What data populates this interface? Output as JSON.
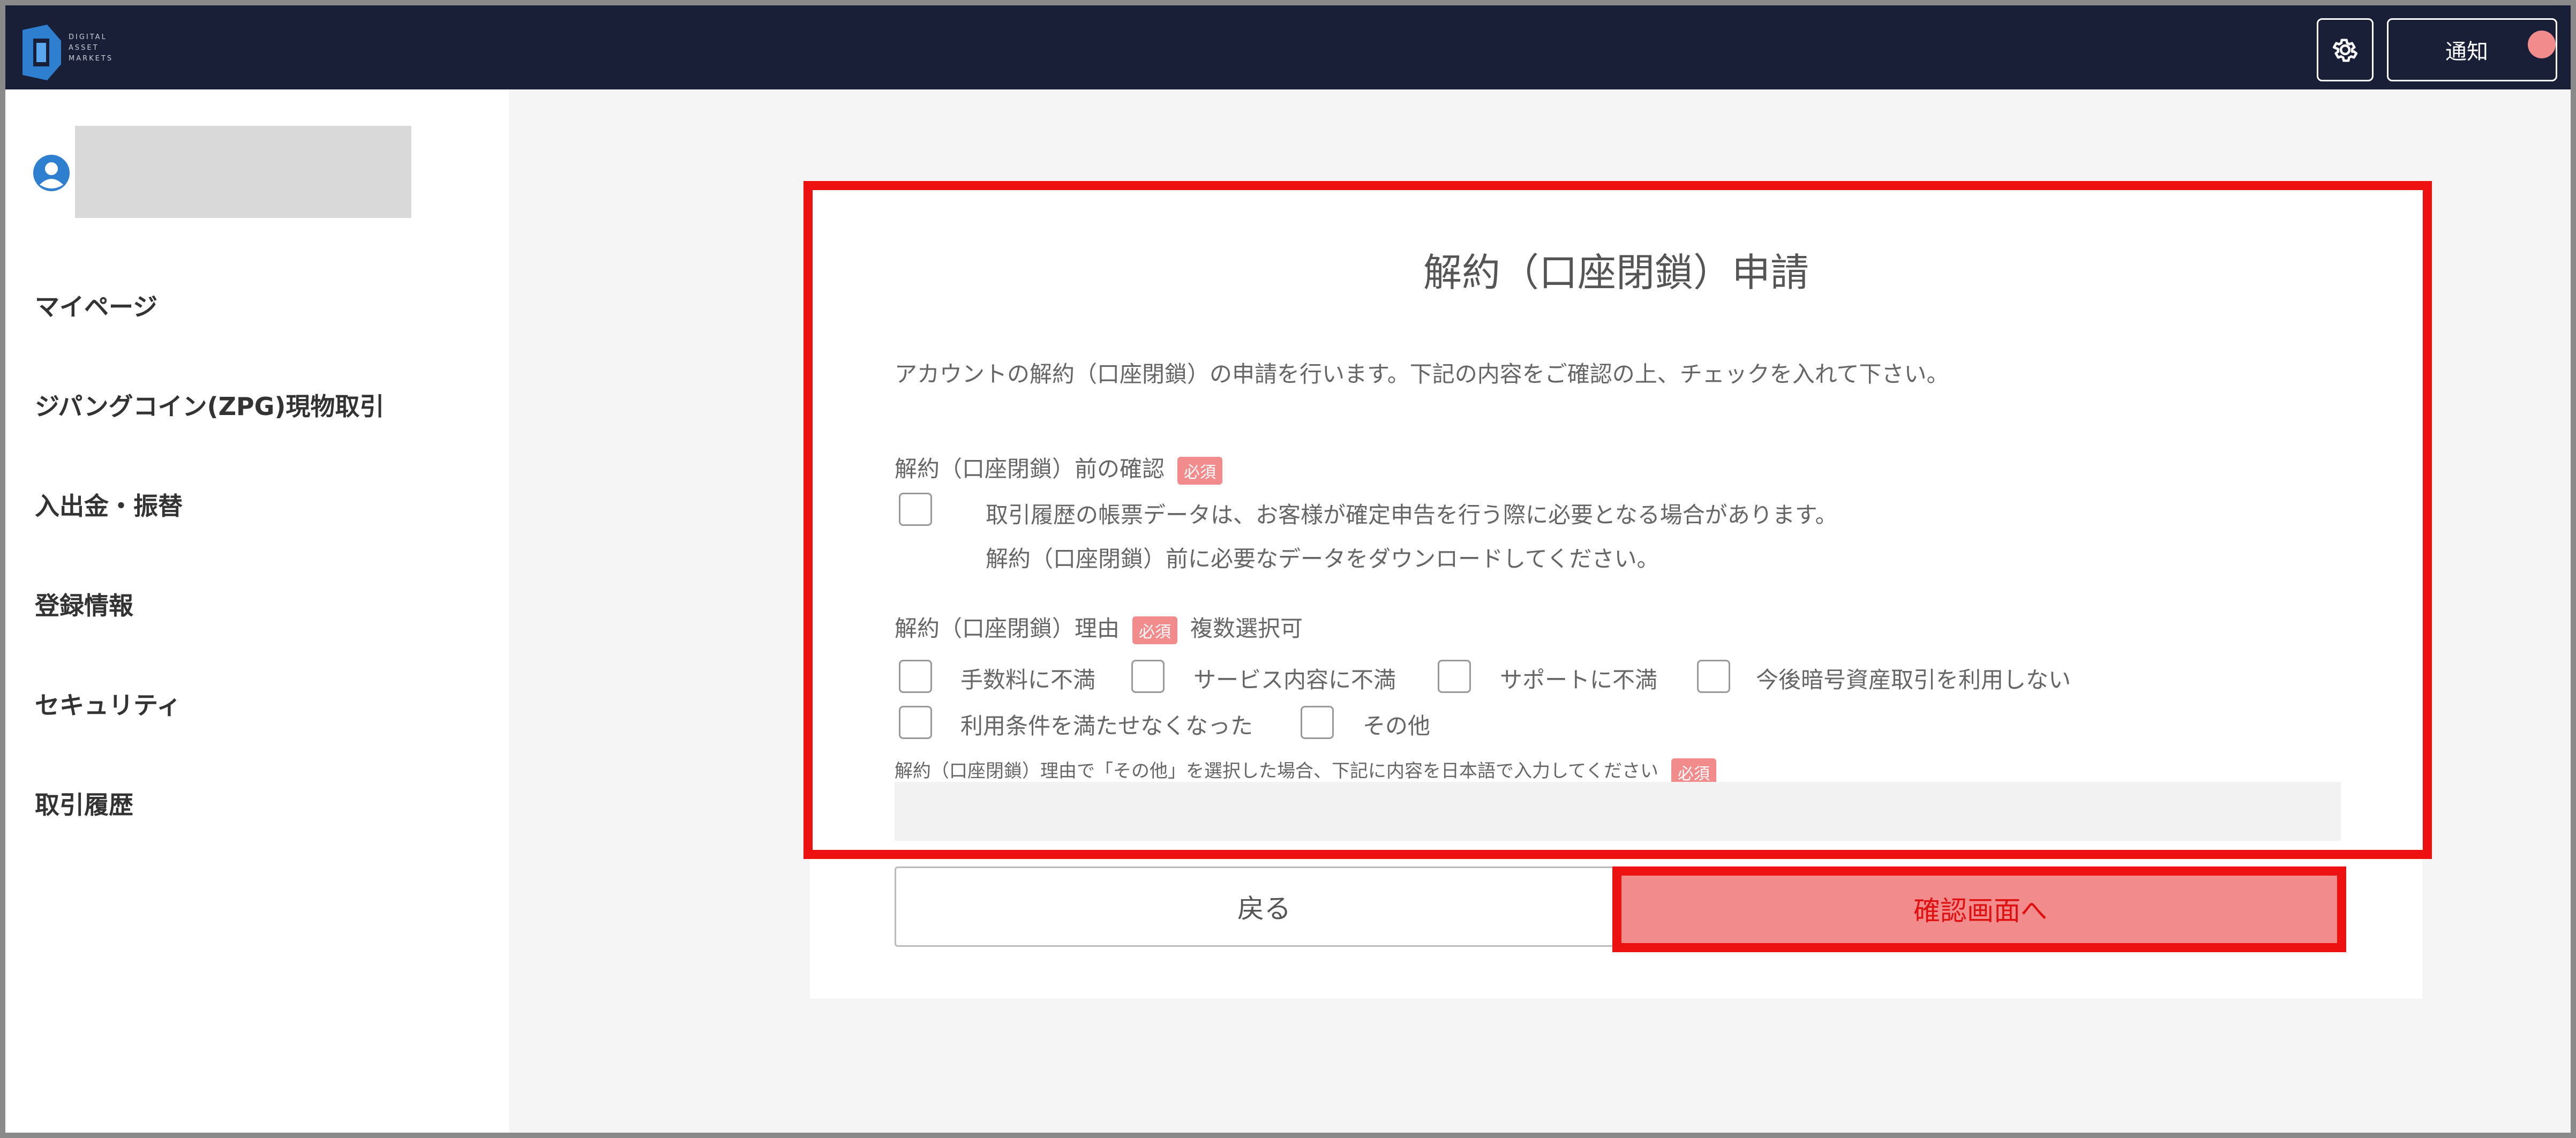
{
  "header": {
    "logo_words": [
      "DIGITAL",
      "ASSET",
      "MARKETS"
    ],
    "notify_label": "通知"
  },
  "sidebar": {
    "items": [
      {
        "label": "マイページ"
      },
      {
        "label": "ジパングコイン(ZPG)現物取引"
      },
      {
        "label": "入出金・振替"
      },
      {
        "label": "登録情報"
      },
      {
        "label": "セキュリティ"
      },
      {
        "label": "取引履歴"
      }
    ]
  },
  "form": {
    "title": "解約（口座閉鎖）申請",
    "intro": "アカウントの解約（口座閉鎖）の申請を行います。下記の内容をご確認の上、チェックを入れて下さい。",
    "confirm_section": {
      "label": "解約（口座閉鎖）前の確認",
      "badge": "必須",
      "line1": "取引履歴の帳票データは、お客様が確定申告を行う際に必要となる場合があります。",
      "line2": "解約（口座閉鎖）前に必要なデータをダウンロードしてください。"
    },
    "reason_section": {
      "label": "解約（口座閉鎖）理由",
      "badge": "必須",
      "multi": "複数選択可",
      "options": [
        "手数料に不満",
        "サービス内容に不満",
        "サポートに不満",
        "今後暗号資産取引を利用しない",
        "利用条件を満たせなくなった",
        "その他"
      ]
    },
    "other_note": {
      "label": "解約（口座閉鎖）理由で「その他」を選択した場合、下記に内容を日本語で入力してください",
      "badge": "必須",
      "value": ""
    },
    "back_label": "戻る",
    "confirm_label": "確認画面へ"
  },
  "colors": {
    "topbar": "#1a1f38",
    "accent_red": "#ee1111",
    "badge_pink": "#f28b8b"
  }
}
